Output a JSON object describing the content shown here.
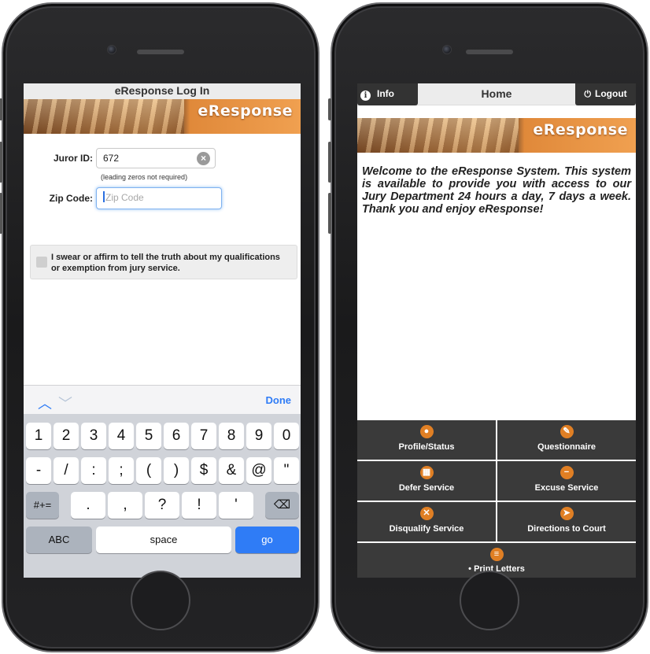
{
  "left_phone": {
    "title": "eResponse Log In",
    "banner_text": "eResponse",
    "juror_id": {
      "label": "Juror ID:",
      "value": "672",
      "hint": "(leading zeros not required)"
    },
    "zip_code": {
      "label": "Zip Code:",
      "placeholder": "Zip Code"
    },
    "oath_text": "I swear or affirm to tell the truth about my qualifications or exemption from jury service.",
    "keyboard": {
      "done_label": "Done",
      "row1": [
        "1",
        "2",
        "3",
        "4",
        "5",
        "6",
        "7",
        "8",
        "9",
        "0"
      ],
      "row2": [
        "-",
        "/",
        ":",
        ";",
        "(",
        ")",
        "$",
        "&",
        "@",
        "\""
      ],
      "row3_left": "#+=",
      "row3": [
        ".",
        ",",
        "?",
        "!",
        "'"
      ],
      "abc_label": "ABC",
      "space_label": "space",
      "go_label": "go"
    }
  },
  "right_phone": {
    "info_label": "Info",
    "title": "Home",
    "logout_label": "Logout",
    "banner_text": "eResponse",
    "welcome_text": "Welcome to the eResponse System. This system is available to provide you with access to our Jury Department 24 hours a day, 7 days a week. Thank you and enjoy eResponse!",
    "menu": [
      {
        "label": "Profile/Status",
        "icon": "person-icon"
      },
      {
        "label": "Questionnaire",
        "icon": "pencil-icon"
      },
      {
        "label": "Defer Service",
        "icon": "calendar-icon"
      },
      {
        "label": "Excuse Service",
        "icon": "minus-icon"
      },
      {
        "label": "Disqualify Service",
        "icon": "x-icon"
      },
      {
        "label": "Directions to Court",
        "icon": "navigation-arrow-icon"
      },
      {
        "label": "Print Letters",
        "icon": "list-icon"
      }
    ],
    "accent_color": "#e07f24"
  }
}
